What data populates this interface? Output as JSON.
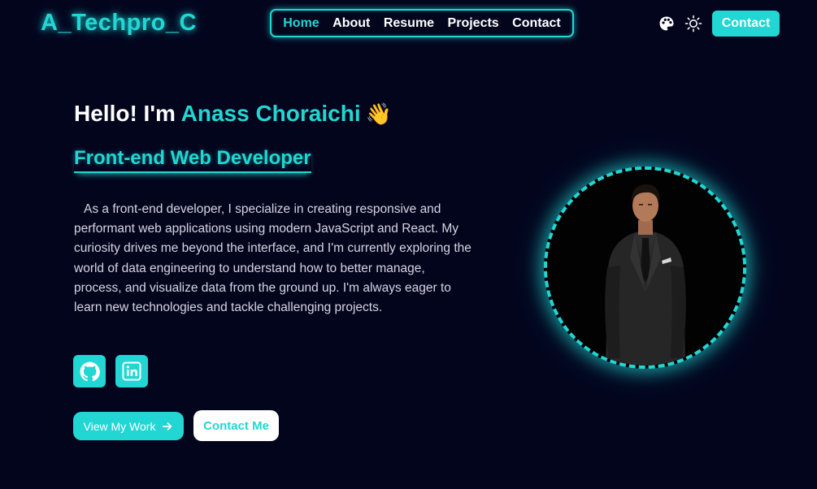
{
  "header": {
    "brand": "A_Techpro_C",
    "nav": [
      {
        "label": "Home",
        "active": true
      },
      {
        "label": "About",
        "active": false
      },
      {
        "label": "Resume",
        "active": false
      },
      {
        "label": "Projects",
        "active": false
      },
      {
        "label": "Contact",
        "active": false
      }
    ],
    "icons": [
      "palette-icon",
      "sun-icon"
    ],
    "contact_button": "Contact"
  },
  "hero": {
    "greeting_prefix": "Hello! I'm ",
    "name": "Anass Choraichi",
    "wave": "👋",
    "role": "Front-end Web Developer",
    "bio": "As a front-end developer, I specialize in creating responsive and performant web applications using modern JavaScript and React. My curiosity drives me beyond the interface, and I'm currently exploring the world of data engineering to understand how to better manage, process, and visualize data from the ground up. I'm always eager to learn new technologies and tackle challenging projects.",
    "social": [
      "github-icon",
      "linkedin-icon"
    ],
    "primary_button": "View My Work",
    "secondary_button": "Contact Me"
  },
  "colors": {
    "background": "#03051d",
    "accent": "#22d6d3",
    "text": "#ffffff",
    "muted_text": "#d4d6e2"
  }
}
